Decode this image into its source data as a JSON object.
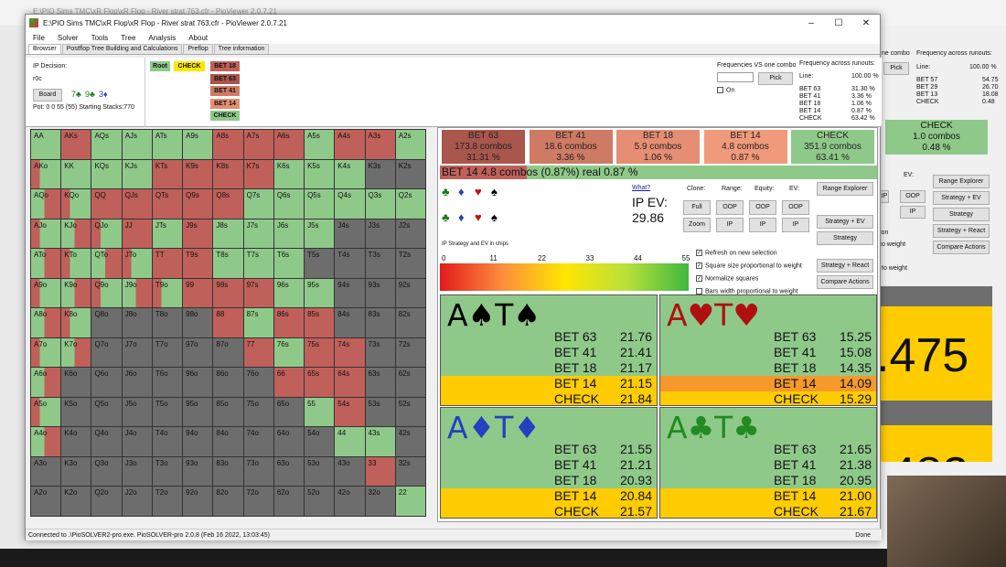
{
  "bg": {
    "title": "E:\\PIO Sims TMC\\xR Flop\\xR Flop - River strat 763.cfr - PioViewer 2.0.7.21",
    "combo_tab": "ne combo",
    "freq_title": "Frequency across runouts:",
    "pick": "Pick",
    "line": "Line:",
    "line_pct": "100.00 %",
    "freq": [
      [
        "BET 57",
        "54.75"
      ],
      [
        "BET 29",
        "26.70"
      ],
      [
        "BET 13",
        "18.08"
      ],
      [
        "CHECK",
        "0.48"
      ]
    ],
    "check_label": "CHECK",
    "check_combos": "1.0 combos",
    "check_pct": "0.48 %",
    "ev_label": "EV:",
    "oop": "OOP",
    "ip": "IP",
    "buttons": [
      "Range Explorer",
      "Strategy + EV",
      "Strategy",
      "Strategy + React",
      "Compare Actions"
    ],
    "weight1": "ion",
    "weight2": "to weight",
    "weight3": "to weight",
    "big1": ".475",
    "big2": ".482"
  },
  "window": {
    "title": "E:\\PIO Sims TMC\\xR Flop\\xR Flop - River strat 763.cfr - PioViewer 2.0.7.21",
    "menu": [
      "File",
      "Solver",
      "Tools",
      "Tree",
      "Analysis",
      "About"
    ],
    "tabs": [
      "Browser",
      "Postflop Tree Building and Calculations",
      "Preflop",
      "Tree information"
    ]
  },
  "top": {
    "ip_decision": "IP Decision:",
    "r0c": "r0c",
    "board_btn": "Board",
    "board": [
      "7♣",
      "9♣",
      "3♦"
    ],
    "pot": "Pot: 0 0 55 (55) Starting Stacks:770",
    "root": "Root",
    "check": "CHECK",
    "nodes": [
      "BET 18",
      "BET 63",
      "BET 41",
      "BET 14",
      "CHECK"
    ],
    "freq_vs_combo": "Frequencies VS one combo",
    "pick": "Pick",
    "on": "On",
    "freq_title": "Frequency across runouts:",
    "line": "Line:",
    "line_pct": "100.00 %",
    "freq": [
      [
        "BET 63",
        "31.30 %"
      ],
      [
        "BET 41",
        "3.36 %"
      ],
      [
        "BET 18",
        "1.06 %"
      ],
      [
        "BET 14",
        "0.87 %"
      ],
      [
        "CHECK",
        "63.42 %"
      ]
    ]
  },
  "grid": [
    [
      "AA",
      "AKs",
      "AQs",
      "AJs",
      "ATs",
      "A9s",
      "A8s",
      "A7s",
      "A6s",
      "A5s",
      "A4s",
      "A3s",
      "A2s"
    ],
    [
      "AKo",
      "KK",
      "KQs",
      "KJs",
      "KTs",
      "K9s",
      "K8s",
      "K7s",
      "K6s",
      "K5s",
      "K4s",
      "K3s",
      "K2s"
    ],
    [
      "AQo",
      "KQo",
      "QQ",
      "QJs",
      "QTs",
      "Q9s",
      "Q8s",
      "Q7s",
      "Q6s",
      "Q5s",
      "Q4s",
      "Q3s",
      "Q2s"
    ],
    [
      "AJo",
      "KJo",
      "QJo",
      "JJ",
      "JTs",
      "J9s",
      "J8s",
      "J7s",
      "J6s",
      "J5s",
      "J4s",
      "J3s",
      "J2s"
    ],
    [
      "ATo",
      "KTo",
      "QTo",
      "JTo",
      "TT",
      "T9s",
      "T8s",
      "T7s",
      "T6s",
      "T5s",
      "T4s",
      "T3s",
      "T2s"
    ],
    [
      "A9o",
      "K9o",
      "Q9o",
      "J9o",
      "T9o",
      "99",
      "98s",
      "97s",
      "96s",
      "95s",
      "94s",
      "93s",
      "92s"
    ],
    [
      "A8o",
      "K8o",
      "Q8o",
      "J8o",
      "T8o",
      "98o",
      "88",
      "87s",
      "86s",
      "85s",
      "84s",
      "83s",
      "82s"
    ],
    [
      "A7o",
      "K7o",
      "Q7o",
      "J7o",
      "T7o",
      "97o",
      "87o",
      "77",
      "76s",
      "75s",
      "74s",
      "73s",
      "72s"
    ],
    [
      "A6o",
      "K6o",
      "Q6o",
      "J6o",
      "T6o",
      "96o",
      "86o",
      "76o",
      "66",
      "65s",
      "64s",
      "63s",
      "62s"
    ],
    [
      "A5o",
      "K5o",
      "Q5o",
      "J5o",
      "T5o",
      "95o",
      "85o",
      "75o",
      "65o",
      "55",
      "54s",
      "53s",
      "52s"
    ],
    [
      "A4o",
      "K4o",
      "Q4o",
      "J4o",
      "T4o",
      "94o",
      "84o",
      "74o",
      "64o",
      "54o",
      "44",
      "43s",
      "42s"
    ],
    [
      "A3o",
      "K3o",
      "Q3o",
      "J3o",
      "T3o",
      "93o",
      "83o",
      "73o",
      "63o",
      "53o",
      "43o",
      "33",
      "32s"
    ],
    [
      "A2o",
      "K2o",
      "Q2o",
      "J2o",
      "T2o",
      "92o",
      "82o",
      "72o",
      "62o",
      "52o",
      "42o",
      "32o",
      "22"
    ]
  ],
  "actions": [
    {
      "name": "BET 63",
      "combos": "173.8 combos",
      "pct": "31.31 %",
      "color": "#a9564c"
    },
    {
      "name": "BET 41",
      "combos": "18.6 combos",
      "pct": "3.36 %",
      "color": "#cf7a64"
    },
    {
      "name": "BET 18",
      "combos": "5.9 combos",
      "pct": "1.06 %",
      "color": "#e58e73"
    },
    {
      "name": "BET 14",
      "combos": "4.8 combos",
      "pct": "0.87 %",
      "color": "#f09a7b"
    },
    {
      "name": "CHECK",
      "combos": "351.9 combos",
      "pct": "63.41 %",
      "color": "#8fc98a"
    }
  ],
  "selection": "BET 14   4.8 combos (0.87%) real  0.87 %",
  "suits": [
    "♣",
    "♦",
    "♥",
    "♠"
  ],
  "what": "What?",
  "ip_ev_label": "IP EV:",
  "ip_ev": "29.86",
  "clone": "Clone:",
  "range": "Range:",
  "equity": "Equity:",
  "ev": "EV:",
  "full": "Full",
  "zoom": "Zoom",
  "oop": "OOP",
  "ip": "IP",
  "right_buttons": [
    "Range Explorer",
    "Strategy + EV",
    "Strategy",
    "Strategy + React",
    "Compare Actions"
  ],
  "checks": [
    "Refresh on new selection",
    "Square size proportional to weight",
    "Normalize squares",
    "Bars width proportional to weight"
  ],
  "legend_title": "IP Strategy and EV in chips",
  "ticks": [
    "0",
    "11",
    "22",
    "33",
    "44",
    "55"
  ],
  "panels": [
    {
      "title_a": "A♠",
      "title_t": "T♠",
      "color": "#000000",
      "rows": [
        [
          "BET 63",
          "21.76"
        ],
        [
          "BET 41",
          "21.41"
        ],
        [
          "BET 18",
          "21.17"
        ],
        [
          "BET 14",
          "21.15"
        ],
        [
          "CHECK",
          "21.84"
        ]
      ]
    },
    {
      "title_a": "A♥",
      "title_t": "T♥",
      "color": "#b01010",
      "rows": [
        [
          "BET 63",
          "15.25"
        ],
        [
          "BET 41",
          "15.08"
        ],
        [
          "BET 18",
          "14.35"
        ],
        [
          "BET 14",
          "14.09"
        ],
        [
          "CHECK",
          "15.29"
        ]
      ]
    },
    {
      "title_a": "A♦",
      "title_t": "T♦",
      "color": "#2540c0",
      "rows": [
        [
          "BET 63",
          "21.55"
        ],
        [
          "BET 41",
          "21.21"
        ],
        [
          "BET 18",
          "20.93"
        ],
        [
          "BET 14",
          "20.84"
        ],
        [
          "CHECK",
          "21.57"
        ]
      ]
    },
    {
      "title_a": "A♣",
      "title_t": "T♣",
      "color": "#228b22",
      "rows": [
        [
          "BET 63",
          "21.65"
        ],
        [
          "BET 41",
          "21.38"
        ],
        [
          "BET 18",
          "20.95"
        ],
        [
          "BET 14",
          "21.00"
        ],
        [
          "CHECK",
          "21.67"
        ]
      ]
    }
  ],
  "status": "Connected to .\\PioSOLVER2-pro.exe. PioSOLVER-pro 2.0.8 (Feb 16 2022, 13:03:45)",
  "done": "Done"
}
